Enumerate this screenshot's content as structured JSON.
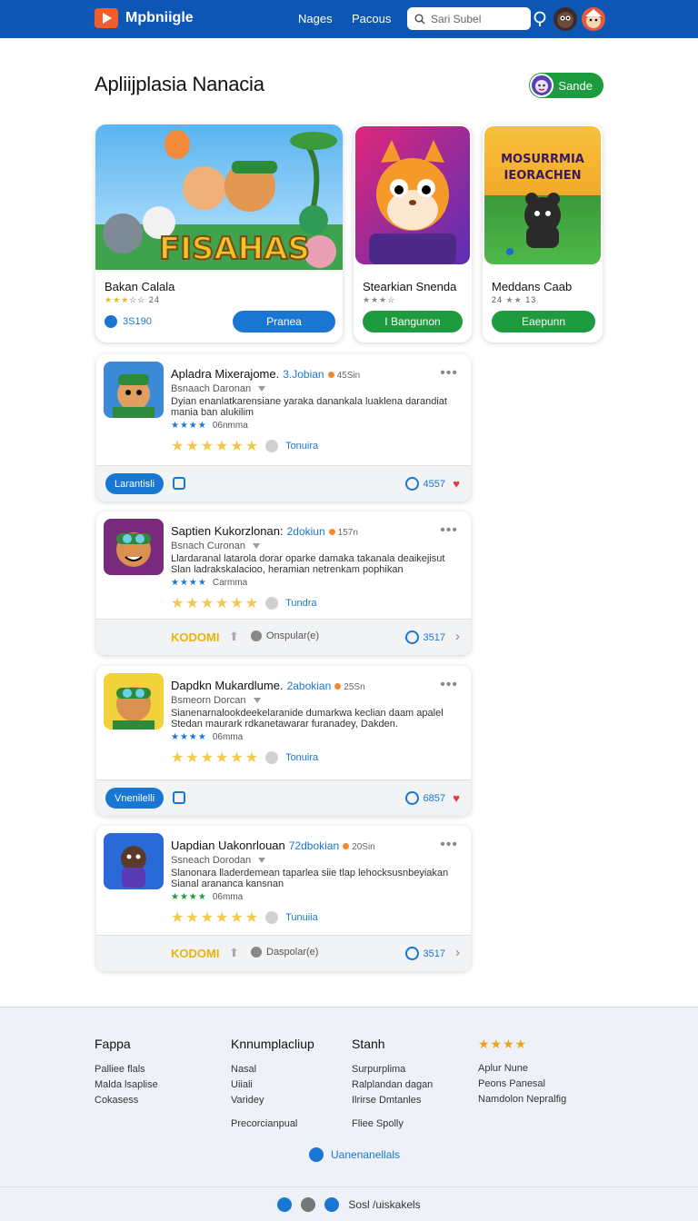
{
  "header": {
    "brand": "Mpbniigle",
    "nav": [
      "Nages",
      "Pacous"
    ],
    "search_placeholder": "Sari Subel"
  },
  "page": {
    "title": "Apliijplasia Nanacia",
    "action_label": "Sande"
  },
  "featured": [
    {
      "art_text": "FISAHAS",
      "name": "Bakan Calala",
      "rating_text": "24",
      "count": "3S190",
      "button": "Pranea"
    },
    {
      "name": "Stearkian Snenda",
      "button": "I Bangunon"
    },
    {
      "art_text": "MOSURRMIA IEORACHEN",
      "name": "Meddans Caab",
      "rating_text": "24",
      "rating_text_2": "13",
      "button": "Eaepunn"
    }
  ],
  "reviews": [
    {
      "title": "Apladra Mixerajome.",
      "chip": "3.Jobian",
      "meta": "45Sin",
      "author": "Bsnaach Daronan",
      "body": "Dyian enanlatkarensiane yaraka danankala luaklena darandiat mania ban alukilim",
      "rating_label": "06nmma",
      "link": "Tonuira",
      "pill": "Larantisli",
      "count": "4557"
    },
    {
      "title": "Saptien Kukorzlonan:",
      "chip": "2dokiun",
      "meta": "157n",
      "author": "Bsnach Curonan",
      "body": "Llardaranal latarola dorar oparke damaka takanala deaikejisut Slan ladrakskalacioo, heramian netrenkam pophikan",
      "rating_label": "Carmma",
      "link": "Tundra",
      "brand": "KODOMI",
      "status": "Onspular(e)",
      "count": "3517"
    },
    {
      "title": "Dapdkn Mukardlume.",
      "chip": "2abokian",
      "meta": "25Sn",
      "author": "Bsmeorn Dorcan",
      "body": "Sianenarnalookdeekelaranide dumarkwa keclian daam apalel Stedan maurark rdkanetawarar furanadey, Dakden.",
      "rating_label": "06mma",
      "link": "Tonuira",
      "pill": "Vnenilelli",
      "count": "6857"
    },
    {
      "title": "Uapdian Uakonrlouan",
      "chip": "72dbokian",
      "meta": "20Sin",
      "author": "Ssneach Dorodan",
      "body": "Slanonara lladerdemean taparlea siie tlap lehocksusnbeyiakan Sianal arananca kansnan",
      "rating_label": "06mma",
      "link": "Tunuiia",
      "brand": "KODOMI",
      "status": "Daspolar(e)",
      "count": "3517"
    }
  ],
  "footer": {
    "columns": [
      {
        "head": "Fappa",
        "items": [
          "Palliee flals",
          "Malda lsaplise",
          "Cokasess"
        ]
      },
      {
        "head": "Knnumplacliup",
        "items": [
          "Nasal",
          "Uiiali",
          "Varidey"
        ],
        "extra": "Precorcianpual"
      },
      {
        "head": "Stanh",
        "items": [
          "Surpurplima",
          "Ralplandan dagan",
          "Ilrirse Dmtanles"
        ],
        "extra": "Fliee Spolly"
      },
      {
        "stars": "★★★★",
        "items": [
          "Aplur Nune",
          "Peons Panesal",
          "Namdolon Nepralfig"
        ]
      }
    ],
    "center_link": "Uanenanellals",
    "bottom_text": "Sosl /uiskakels"
  }
}
